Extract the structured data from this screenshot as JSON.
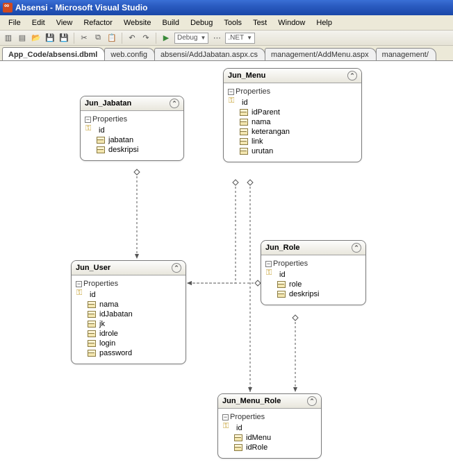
{
  "window": {
    "title": "Absensi - Microsoft Visual Studio"
  },
  "menu": {
    "file": "File",
    "edit": "Edit",
    "view": "View",
    "refactor": "Refactor",
    "website": "Website",
    "build": "Build",
    "debug": "Debug",
    "tools": "Tools",
    "test": "Test",
    "window": "Window",
    "help": "Help"
  },
  "toolbar": {
    "config": "Debug",
    "platform": ".NET"
  },
  "tabs": [
    {
      "label": "App_Code/absensi.dbml",
      "active": true
    },
    {
      "label": "web.config",
      "active": false
    },
    {
      "label": "absensi/AddJabatan.aspx.cs",
      "active": false
    },
    {
      "label": "management/AddMenu.aspx",
      "active": false
    },
    {
      "label": "management/",
      "active": false
    }
  ],
  "entities": {
    "jabatan": {
      "title": "Jun_Jabatan",
      "section": "Properties",
      "props": [
        {
          "name": "id",
          "pk": true
        },
        {
          "name": "jabatan",
          "pk": false
        },
        {
          "name": "deskripsi",
          "pk": false
        }
      ]
    },
    "menu": {
      "title": "Jun_Menu",
      "section": "Properties",
      "props": [
        {
          "name": "id",
          "pk": true
        },
        {
          "name": "idParent",
          "pk": false
        },
        {
          "name": "nama",
          "pk": false
        },
        {
          "name": "keterangan",
          "pk": false
        },
        {
          "name": "link",
          "pk": false
        },
        {
          "name": "urutan",
          "pk": false
        }
      ]
    },
    "user": {
      "title": "Jun_User",
      "section": "Properties",
      "props": [
        {
          "name": "id",
          "pk": true
        },
        {
          "name": "nama",
          "pk": false
        },
        {
          "name": "idJabatan",
          "pk": false
        },
        {
          "name": "jk",
          "pk": false
        },
        {
          "name": "idrole",
          "pk": false
        },
        {
          "name": "login",
          "pk": false
        },
        {
          "name": "password",
          "pk": false
        }
      ]
    },
    "role": {
      "title": "Jun_Role",
      "section": "Properties",
      "props": [
        {
          "name": "id",
          "pk": true
        },
        {
          "name": "role",
          "pk": false
        },
        {
          "name": "deskripsi",
          "pk": false
        }
      ]
    },
    "menurole": {
      "title": "Jun_Menu_Role",
      "section": "Properties",
      "props": [
        {
          "name": "id",
          "pk": true
        },
        {
          "name": "idMenu",
          "pk": false
        },
        {
          "name": "idRole",
          "pk": false
        }
      ]
    }
  }
}
